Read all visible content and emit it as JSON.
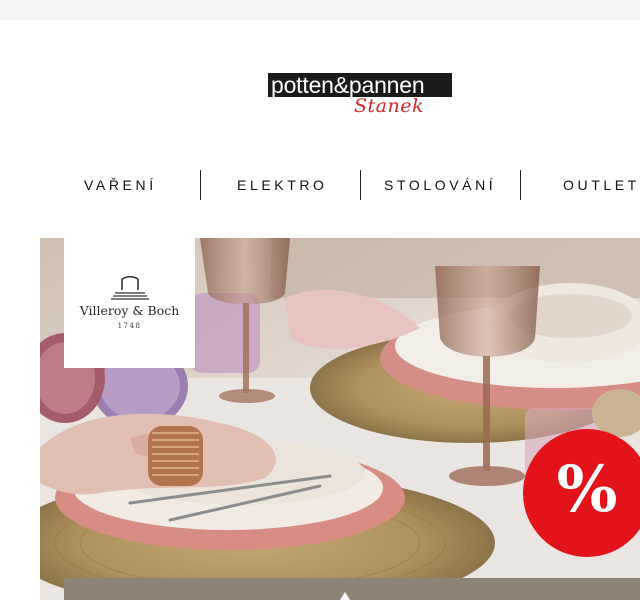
{
  "logo": {
    "main_text": "potten&pannen",
    "script_text": "Stanek"
  },
  "nav": {
    "items": [
      {
        "label": "VAŘENÍ"
      },
      {
        "label": "ELEKTRO"
      },
      {
        "label": "STOLOVÁNÍ"
      },
      {
        "label": "OUTLET"
      }
    ]
  },
  "hero": {
    "brand": {
      "name": "Villeroy & Boch",
      "year": "1748",
      "icon": "villeroy-boch-castle-icon"
    },
    "badge": {
      "text": "%",
      "color": "#e3131b"
    }
  },
  "colors": {
    "accent_red": "#e3131b",
    "logo_black": "#1a1a1a",
    "strip": "#8d8476"
  }
}
